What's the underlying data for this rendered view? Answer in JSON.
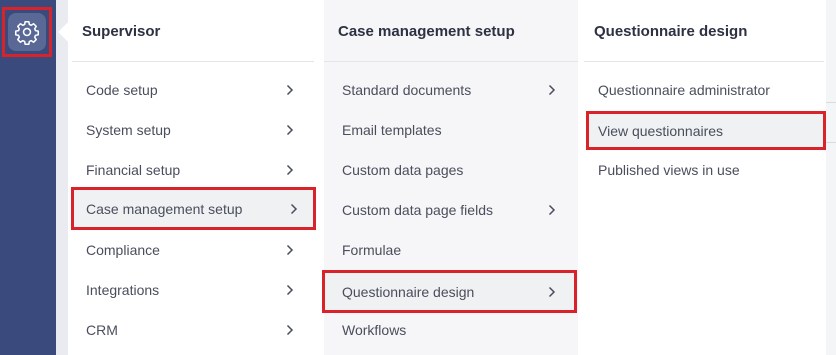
{
  "colors": {
    "sidebar": "#3b4a7c",
    "highlight": "#d8232a",
    "text": "#4a4e5c"
  },
  "sidebar": {
    "settings_icon": "gear-icon"
  },
  "columns": [
    {
      "title": "Supervisor",
      "items": [
        {
          "label": "Code setup",
          "has_submenu": true
        },
        {
          "label": "System setup",
          "has_submenu": true
        },
        {
          "label": "Financial setup",
          "has_submenu": true
        },
        {
          "label": "Case management setup",
          "has_submenu": true,
          "highlighted": true
        },
        {
          "label": "Compliance",
          "has_submenu": true
        },
        {
          "label": "Integrations",
          "has_submenu": true
        },
        {
          "label": "CRM",
          "has_submenu": true
        }
      ]
    },
    {
      "title": "Case management setup",
      "items": [
        {
          "label": "Standard documents",
          "has_submenu": true
        },
        {
          "label": "Email templates",
          "has_submenu": false
        },
        {
          "label": "Custom data pages",
          "has_submenu": false
        },
        {
          "label": "Custom data page fields",
          "has_submenu": true
        },
        {
          "label": "Formulae",
          "has_submenu": false
        },
        {
          "label": "Questionnaire design",
          "has_submenu": true,
          "highlighted": true
        },
        {
          "label": "Workflows",
          "has_submenu": false
        }
      ]
    },
    {
      "title": "Questionnaire design",
      "items": [
        {
          "label": "Questionnaire administrator",
          "has_submenu": false
        },
        {
          "label": "View questionnaires",
          "has_submenu": false,
          "highlighted": true
        },
        {
          "label": "Published views in use",
          "has_submenu": false
        }
      ]
    }
  ]
}
